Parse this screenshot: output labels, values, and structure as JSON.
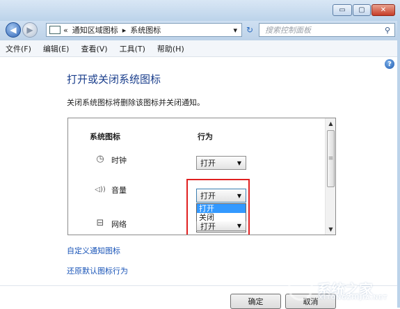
{
  "window": {
    "controls": {
      "minimize": "▭",
      "maximize": "▢",
      "close": "✕"
    }
  },
  "address_bar": {
    "back_icon": "back-arrow-icon",
    "forward_icon": "forward-arrow-icon",
    "overflow": "«",
    "crumb1": "通知区域图标",
    "sep": "▸",
    "crumb2": "系统图标",
    "dropdown": "▾",
    "refresh": "↻",
    "search_placeholder": "搜索控制面板",
    "search_icon": "⚲"
  },
  "menu": [
    "文件(F)",
    "编辑(E)",
    "查看(V)",
    "工具(T)",
    "帮助(H)"
  ],
  "help_glyph": "?",
  "content": {
    "title": "打开或关闭系统图标",
    "subtitle": "关闭系统图标将删除该图标并关闭通知。",
    "col_icon": "系统图标",
    "col_behavior": "行为",
    "rows": [
      {
        "icon": "clock-icon",
        "glyph": "◷",
        "name": "时钟",
        "value": "打开"
      },
      {
        "icon": "volume-icon",
        "glyph": "◁))",
        "name": "音量",
        "value": "打开"
      },
      {
        "icon": "network-icon",
        "glyph": "⊟",
        "name": "网络",
        "value": "打开"
      }
    ],
    "dropdown_options": [
      "打开",
      "关闭"
    ],
    "dropdown_selected": "打开",
    "scroll": {
      "up": "▲",
      "down": "▼",
      "grip": "≡"
    },
    "link_customize": "自定义通知图标",
    "link_restore": "还原默认图标行为"
  },
  "buttons": {
    "ok": "确定",
    "cancel": "取消"
  },
  "watermark": {
    "text": "系统之家",
    "sub": "XITONGZHIJIA.NET"
  }
}
